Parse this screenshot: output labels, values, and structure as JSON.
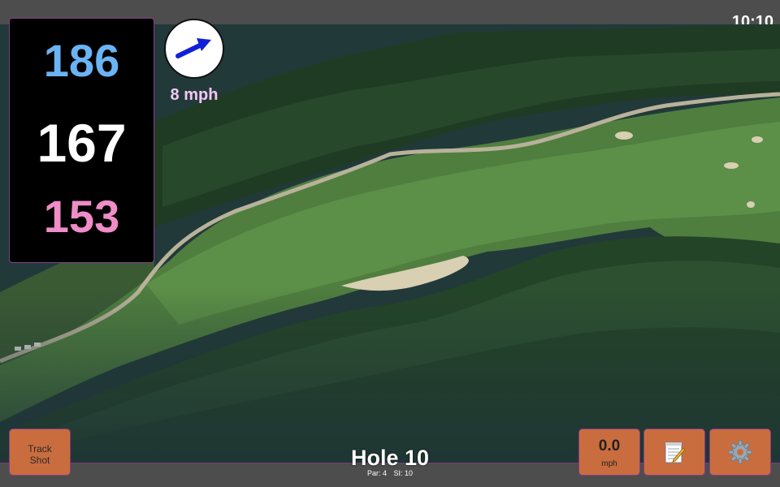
{
  "status_bar": {
    "time": "10:10"
  },
  "distances": {
    "back": "186",
    "middle": "167",
    "front": "153"
  },
  "wind": {
    "speed_label": "8 mph",
    "direction_icon": "wind-arrow-icon"
  },
  "hole": {
    "title": "Hole 10",
    "par": "Par: 4",
    "stroke_index": "SI: 10"
  },
  "buttons": {
    "track_shot_line1": "Track",
    "track_shot_line2": "Shot",
    "speed_value": "0.0",
    "speed_unit": "mph",
    "notes_icon": "notepad-icon",
    "settings_icon": "gear-icon"
  },
  "colors": {
    "back_distance": "#6ab4f5",
    "middle_distance": "#ffffff",
    "front_distance": "#f08cc8",
    "wind_label": "#f4c8f4",
    "button_bg": "#c96d3f",
    "accent_border": "#8a3a8a"
  }
}
